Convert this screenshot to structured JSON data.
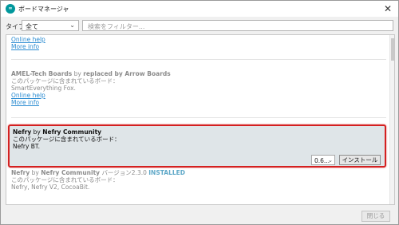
{
  "window": {
    "title": "ボードマネージャ",
    "app_icon_text": "∞",
    "close_glyph": "✕"
  },
  "filter": {
    "type_label": "タイプ",
    "type_value": "全て",
    "search_placeholder": "検索をフィルター..."
  },
  "list": {
    "partial_entry": {
      "link_online_help": "Online help",
      "link_more_info": "More info"
    },
    "amel": {
      "name": "AMEL-Tech Boards",
      "by": "by",
      "author": "replaced by Arrow Boards",
      "boards_heading": "このパッケージに含まれているボード：",
      "boards": "SmartEverything Fox.",
      "link_online_help": "Online help",
      "link_more_info": "More info"
    },
    "selected": {
      "name": "Nefry",
      "by": "by",
      "author": "Nefry Community",
      "boards_heading": "このパッケージに含まれているボード：",
      "boards": "Nefry BT.",
      "version_value": "0.6...",
      "install_label": "インストール"
    },
    "installed": {
      "name": "Nefry",
      "by": "by",
      "author": "Nefry Community",
      "version_text": "バージョン2.3.0",
      "status": "INSTALLED",
      "boards_heading": "このパッケージに含まれているボード：",
      "boards": "Nefry, Nefry V2, CocoaBit."
    }
  },
  "footer": {
    "close_label": "閉じる"
  },
  "colors": {
    "highlight_border": "#d42020",
    "link": "#2a8bd1",
    "installed_status": "#5fa8c8"
  }
}
